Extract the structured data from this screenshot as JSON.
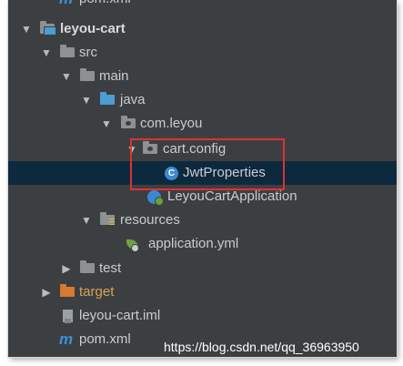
{
  "tree": {
    "partial_top_label": "pom.xml",
    "items": [
      {
        "label": "leyou-cart",
        "icon": "module-folder-icon",
        "expanded": true
      },
      {
        "label": "src",
        "icon": "folder-icon",
        "expanded": true
      },
      {
        "label": "main",
        "icon": "folder-icon",
        "expanded": true
      },
      {
        "label": "java",
        "icon": "source-folder-icon",
        "expanded": true
      },
      {
        "label": "com.leyou",
        "icon": "package-icon",
        "expanded": true
      },
      {
        "label": "cart.config",
        "icon": "package-icon",
        "expanded": true
      },
      {
        "label": "JwtProperties",
        "icon": "java-class-icon",
        "class_icon_letter": "C",
        "selected": true
      },
      {
        "label": "LeyouCartApplication",
        "icon": "spring-boot-app-icon"
      },
      {
        "label": "resources",
        "icon": "resources-folder-icon",
        "expanded": true
      },
      {
        "label": "application.yml",
        "icon": "spring-yml-icon"
      },
      {
        "label": "test",
        "icon": "folder-icon",
        "expanded": false
      },
      {
        "label": "target",
        "icon": "excluded-folder-icon",
        "expanded": false
      },
      {
        "label": "leyou-cart.iml",
        "icon": "iml-file-icon"
      },
      {
        "label": "pom.xml",
        "icon": "maven-icon",
        "icon_glyph": "m"
      }
    ]
  },
  "watermark": "https://blog.csdn.net/qq_36963950",
  "colors": {
    "background": "#3c3f41",
    "selection": "#0d293e",
    "highlight_border": "#e03131",
    "text": "#c9cdd1"
  }
}
